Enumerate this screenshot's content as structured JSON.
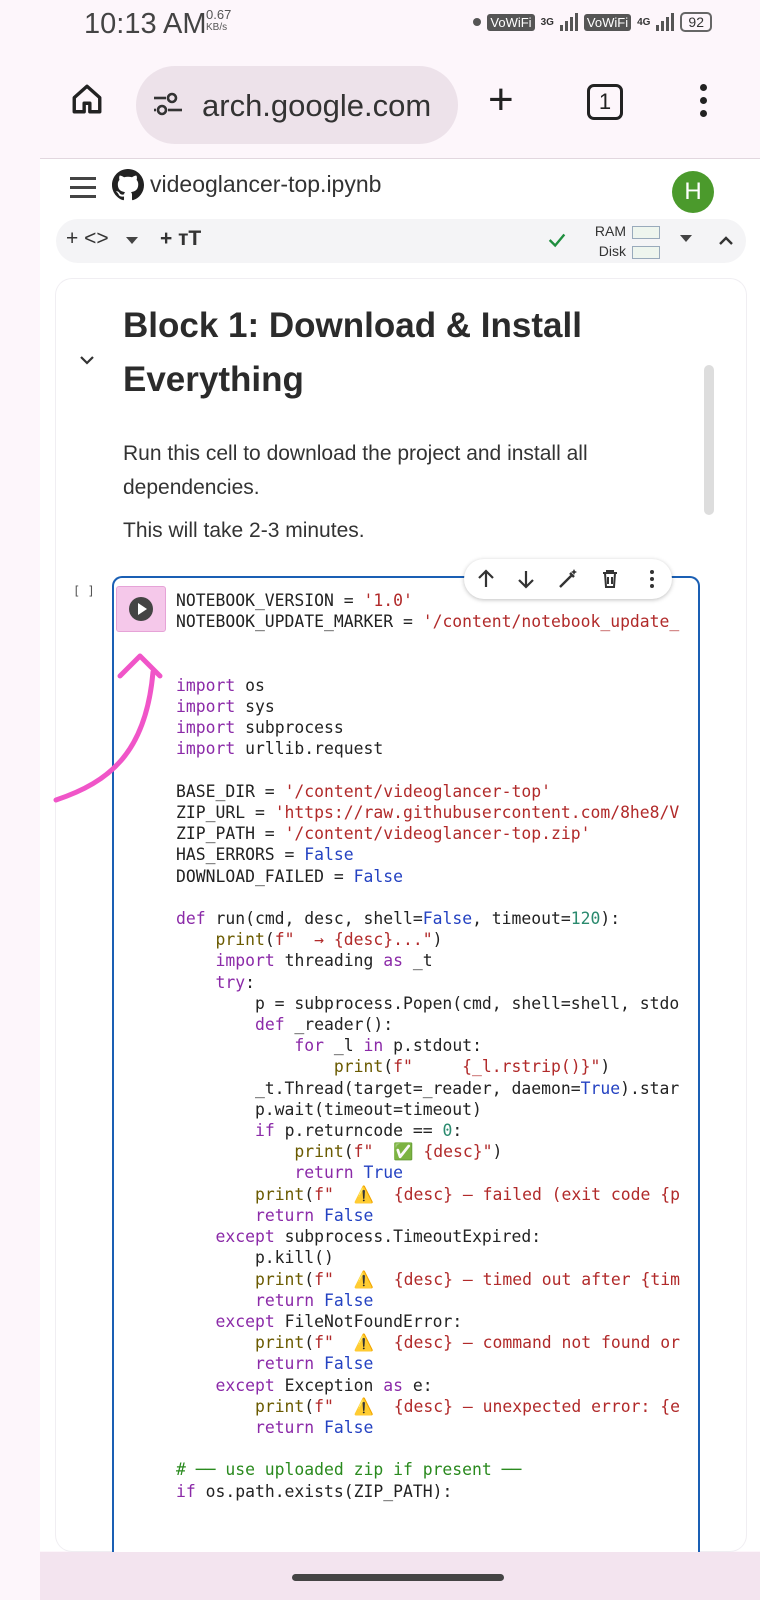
{
  "status_bar": {
    "time": "10:13 AM",
    "speed_value": "0.67",
    "speed_unit": "KB/s",
    "vowifi_1": "VoWiFi",
    "net_1": "3G",
    "vowifi_2": "VoWiFi",
    "net_2": "4G",
    "battery": "92"
  },
  "browser": {
    "url": "arch.google.com",
    "tab_count": "1"
  },
  "notebook": {
    "title": "videoglancer-top.ipynb",
    "avatar_letter": "H",
    "toolbar": {
      "add_code": "+ <>",
      "add_text": "+ ᴛT",
      "ram_label": "RAM",
      "disk_label": "Disk"
    }
  },
  "text_cell": {
    "heading": "Block 1: Download & Install Everything",
    "para1": "Run this cell to download the project and install all dependencies.",
    "para2": "This will take 2-3 minutes."
  },
  "code_cell": {
    "exec_count": "[ ]",
    "lines": [
      "NOTEBOOK_VERSION = '1.0'",
      "NOTEBOOK_UPDATE_MARKER = '/content/notebook_update_",
      "",
      "",
      "import os",
      "import sys",
      "import subprocess",
      "import urllib.request",
      "",
      "BASE_DIR = '/content/videoglancer-top'",
      "ZIP_URL = 'https://raw.githubusercontent.com/8he8/V",
      "ZIP_PATH = '/content/videoglancer-top.zip'",
      "HAS_ERRORS = False",
      "DOWNLOAD_FAILED = False",
      "",
      "def run(cmd, desc, shell=False, timeout=120):",
      "    print(f\"  → {desc}...\")",
      "    import threading as _t",
      "    try:",
      "        p = subprocess.Popen(cmd, shell=shell, stdo",
      "        def _reader():",
      "            for _l in p.stdout:",
      "                print(f\"     {_l.rstrip()}\")",
      "        _t.Thread(target=_reader, daemon=True).star",
      "        p.wait(timeout=timeout)",
      "        if p.returncode == 0:",
      "            print(f\"  ✅ {desc}\")",
      "            return True",
      "        print(f\"  ⚠️  {desc} — failed (exit code {p",
      "        return False",
      "    except subprocess.TimeoutExpired:",
      "        p.kill()",
      "        print(f\"  ⚠️  {desc} — timed out after {tim",
      "        return False",
      "    except FileNotFoundError:",
      "        print(f\"  ⚠️  {desc} — command not found or",
      "        return False",
      "    except Exception as e:",
      "        print(f\"  ⚠️  {desc} — unexpected error: {e",
      "        return False",
      "",
      "# ── use uploaded zip if present ──",
      "if os.path.exists(ZIP_PATH):"
    ]
  }
}
